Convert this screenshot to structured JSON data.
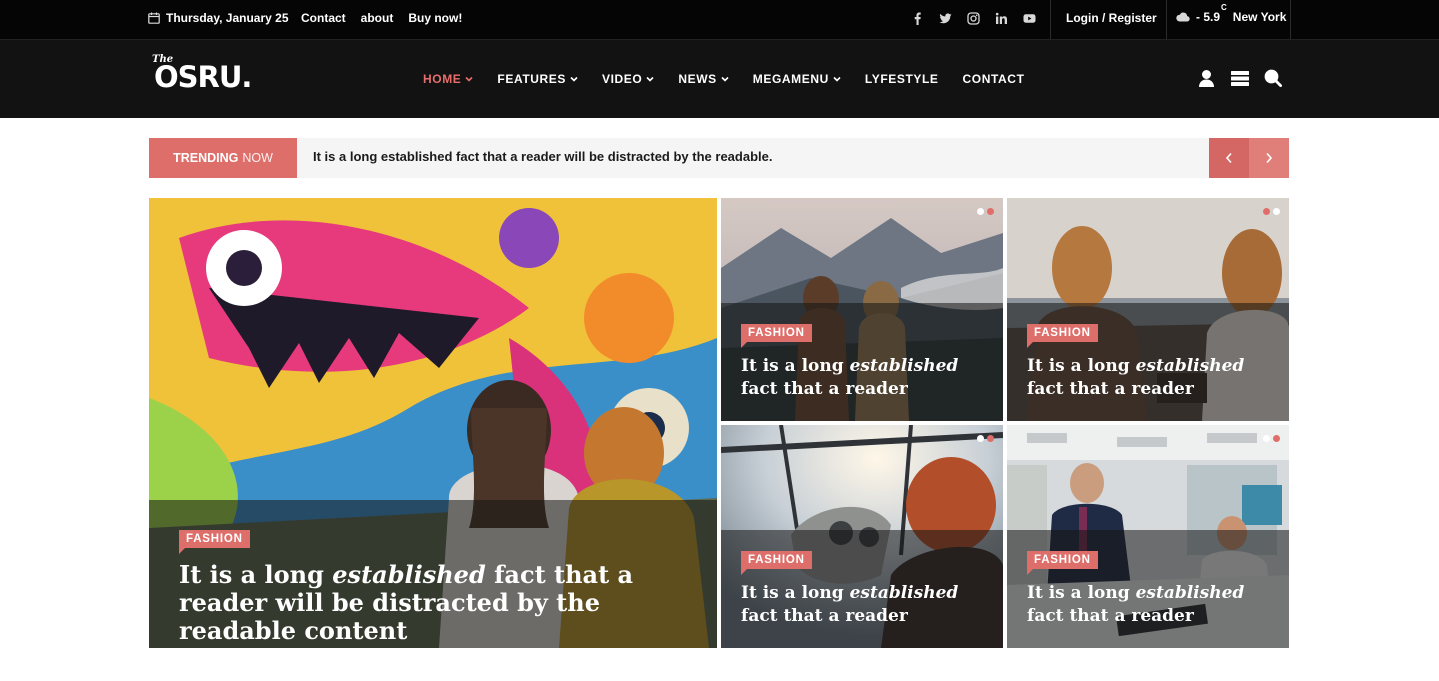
{
  "topbar": {
    "date": "Thursday, January 25",
    "links": [
      "Contact",
      "about",
      "Buy now!"
    ],
    "socials": [
      "facebook-icon",
      "twitter-icon",
      "instagram-icon",
      "linkedin-icon",
      "youtube-icon"
    ],
    "login": "Login / Register",
    "weather": {
      "temp": "- 5.9",
      "unit": "C",
      "city": "New York"
    }
  },
  "header": {
    "logo_small": "The",
    "logo": "OSRU.",
    "nav": [
      {
        "label": "HOME",
        "dropdown": true,
        "active": true
      },
      {
        "label": "FEATURES",
        "dropdown": true
      },
      {
        "label": "VIDEO",
        "dropdown": true
      },
      {
        "label": "NEWS",
        "dropdown": true
      },
      {
        "label": "MEGAMENU",
        "dropdown": true
      },
      {
        "label": "LYFESTYLE",
        "dropdown": false
      },
      {
        "label": "CONTACT",
        "dropdown": false
      }
    ],
    "icons": [
      "user-icon",
      "menu-icon",
      "search-icon"
    ]
  },
  "trending": {
    "label": "TRENDING",
    "label_suffix": "NOW",
    "headline": "It is a long established fact that a reader will be distracted by the readable.",
    "prev_label": "‹",
    "next_label": "›"
  },
  "featured": {
    "category": "FASHION",
    "title_pre": "It is a long ",
    "title_em": "established",
    "title_post": " fact that a reader will be distracted by the readable content"
  },
  "cards": [
    {
      "category": "FASHION",
      "title_pre": "It is a long ",
      "title_em": "established",
      "title_post": " fact that a reader"
    },
    {
      "category": "FASHION",
      "title_pre": "It is a long ",
      "title_em": "established",
      "title_post": " fact that a reader"
    },
    {
      "category": "FASHION",
      "title_pre": "It is a long ",
      "title_em": "established",
      "title_post": " fact that a reader"
    },
    {
      "category": "FASHION",
      "title_pre": "It is a long ",
      "title_em": "established",
      "title_post": " fact that a reader"
    }
  ],
  "colors": {
    "accent": "#de6e6a",
    "topbar": "#050505",
    "header": "#121212"
  }
}
